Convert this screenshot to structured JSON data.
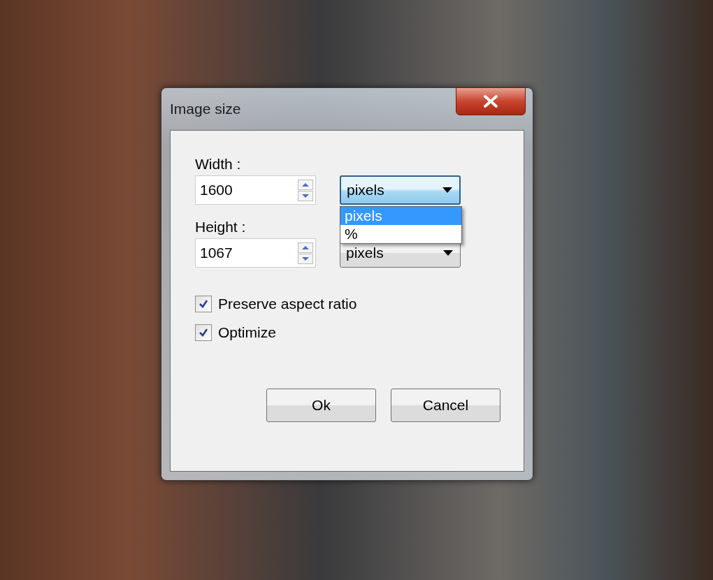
{
  "window": {
    "title": "Image size"
  },
  "fields": [
    {
      "label": "Width :",
      "value": "1600",
      "unit": "pixels",
      "expanded": true,
      "options": [
        {
          "label": "pixels",
          "selected": true
        },
        {
          "label": "%",
          "selected": false
        }
      ]
    },
    {
      "label": "Height :",
      "value": "1067",
      "unit": "pixels",
      "expanded": false
    }
  ],
  "checkboxes": [
    {
      "label": "Preserve aspect ratio",
      "checked": true
    },
    {
      "label": "Optimize",
      "checked": true
    }
  ],
  "buttons": [
    "Ok",
    "Cancel"
  ]
}
